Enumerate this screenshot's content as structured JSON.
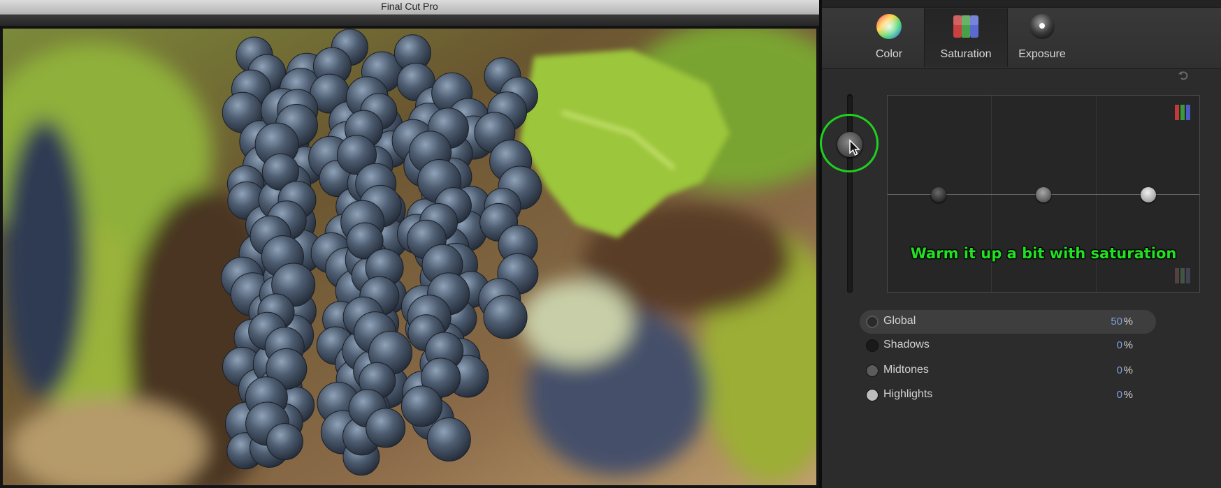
{
  "window": {
    "title": "Final Cut Pro"
  },
  "inspector": {
    "tabs": [
      {
        "label": "Color",
        "icon": "color-wheel-icon",
        "active": false
      },
      {
        "label": "Saturation",
        "icon": "saturation-icon",
        "active": true
      },
      {
        "label": "Exposure",
        "icon": "exposure-icon",
        "active": false
      }
    ],
    "annotation": "Warm it up a bit with saturation",
    "rows": [
      {
        "label": "Global",
        "value": "50",
        "unit": "%"
      },
      {
        "label": "Shadows",
        "value": "0",
        "unit": "%"
      },
      {
        "label": "Midtones",
        "value": "0",
        "unit": "%"
      },
      {
        "label": "Highlights",
        "value": "0",
        "unit": "%"
      }
    ],
    "accent_color": "#22e022",
    "value_color": "#7f9fe0"
  }
}
